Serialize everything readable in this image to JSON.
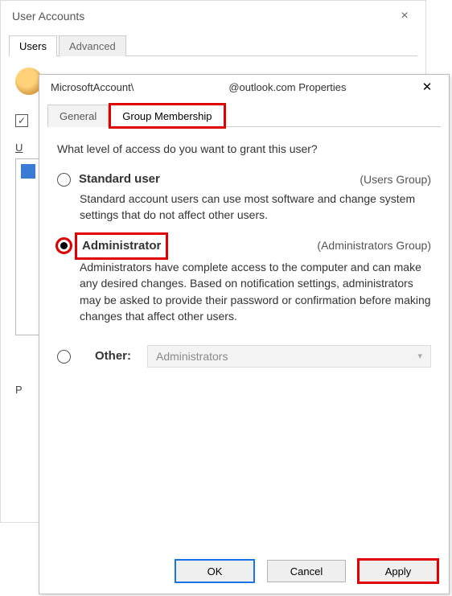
{
  "parent": {
    "title": "User Accounts",
    "close": "×",
    "tabs": {
      "users": "Users",
      "advanced": "Advanced"
    },
    "check_mark": "✓",
    "users_label": "U",
    "p_letter": "P"
  },
  "child": {
    "title_prefix": "MicrosoftAccount\\",
    "title_suffix": "@outlook.com Properties",
    "close": "✕",
    "tabs": {
      "general": "General",
      "group": "Group Membership"
    },
    "question": "What level of access do you want to grant this user?",
    "standard": {
      "title": "Standard user",
      "group": "(Users Group)",
      "desc": "Standard account users can use most software and change system settings that do not affect other users."
    },
    "admin": {
      "title": "Administrator",
      "group": "(Administrators Group)",
      "desc": "Administrators have complete access to the computer and can make any desired changes. Based on notification settings, administrators may be asked to provide their password or confirmation before making changes that affect other users."
    },
    "other": {
      "title": "Other:",
      "selected": "Administrators"
    },
    "buttons": {
      "ok": "OK",
      "cancel": "Cancel",
      "apply": "Apply"
    }
  }
}
